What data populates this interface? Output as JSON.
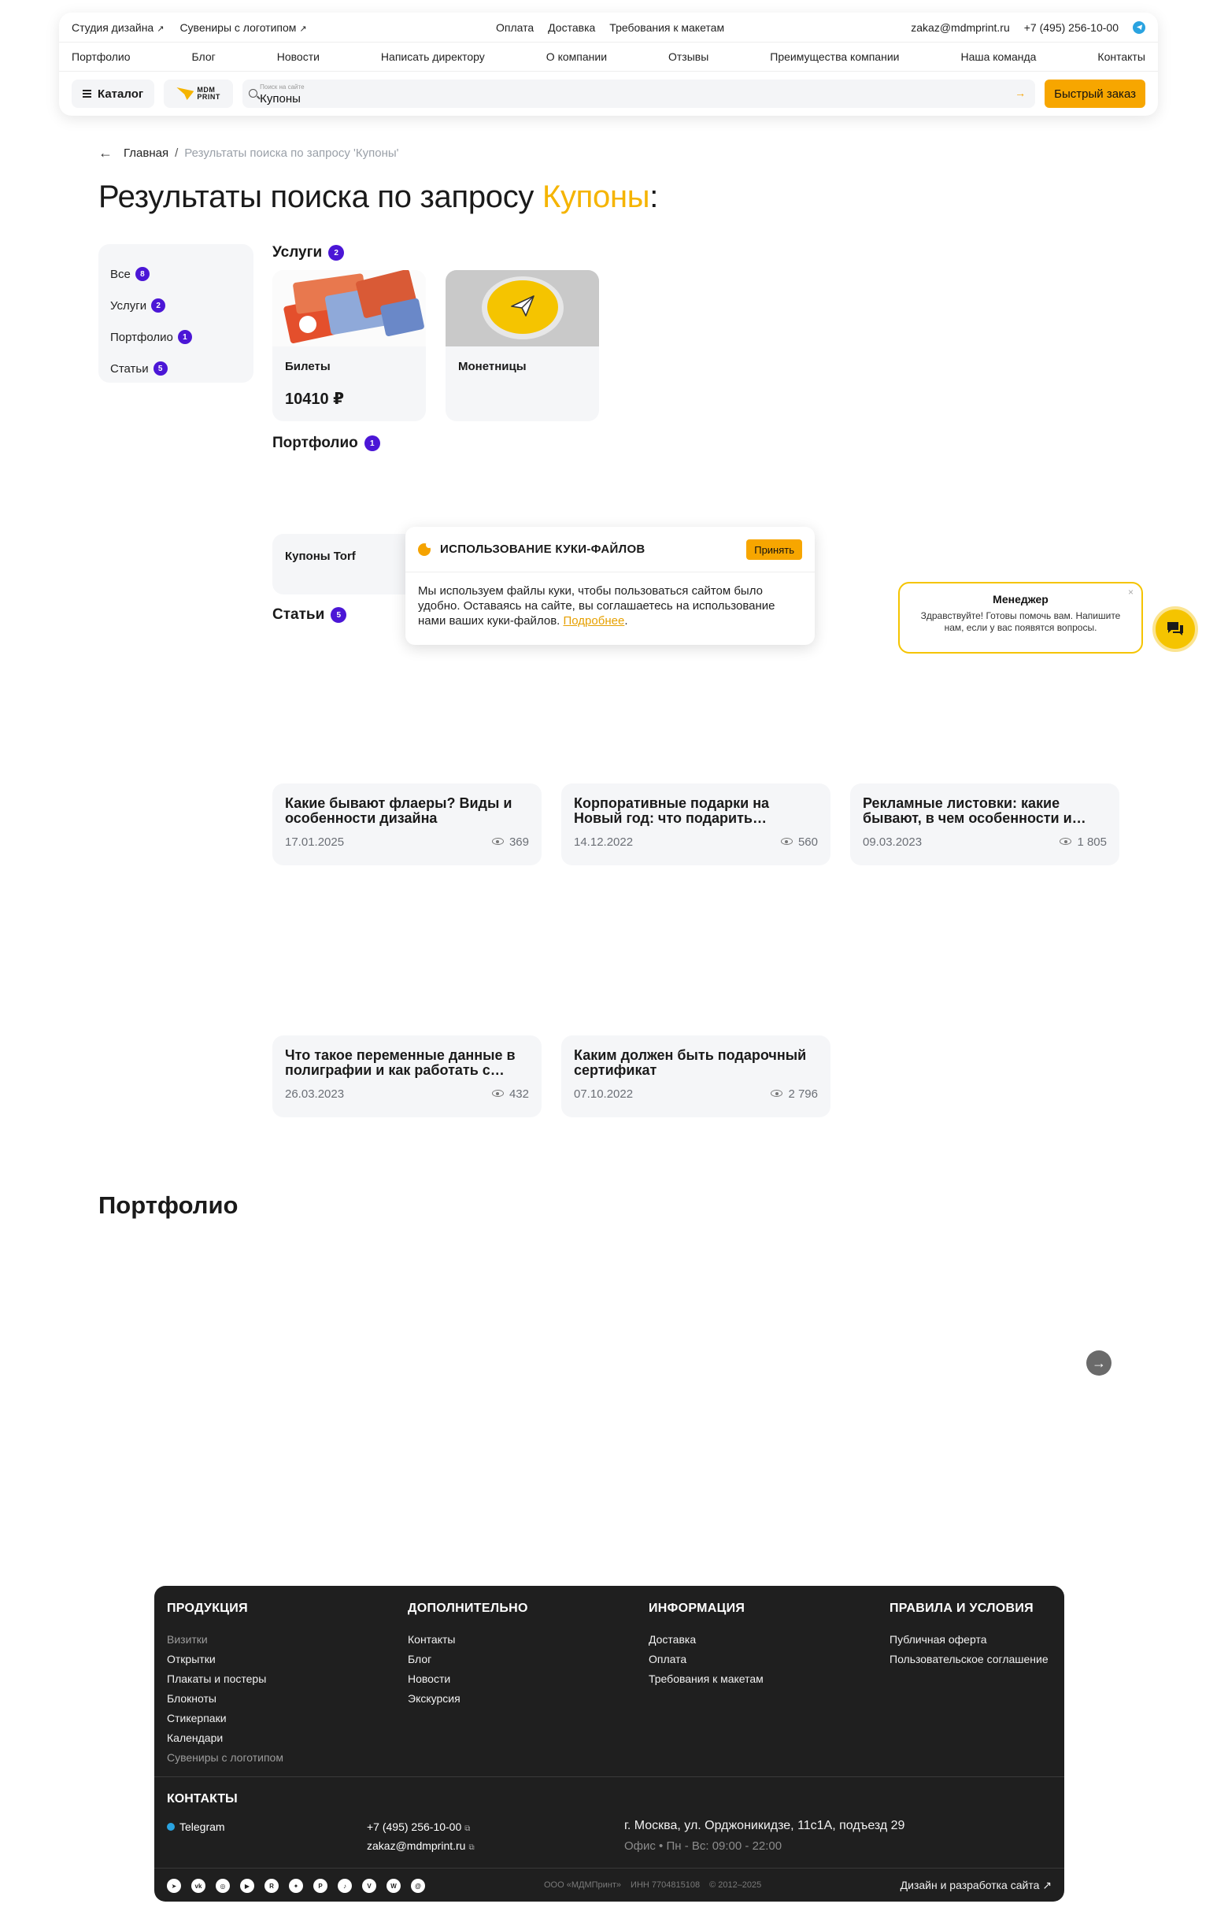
{
  "header": {
    "top_left": [
      {
        "label": "Студия дизайна",
        "arrow": "↗"
      },
      {
        "label": "Сувениры с логотипом",
        "arrow": "↗"
      }
    ],
    "top_center": [
      "Оплата",
      "Доставка",
      "Требования к макетам"
    ],
    "email": "zakaz@mdmprint.ru",
    "phone": "+7 (495) 256-10-00",
    "nav": [
      "Портфолио",
      "Блог",
      "Новости",
      "Написать директору",
      "О компании",
      "Отзывы",
      "Преимущества компании",
      "Наша команда",
      "Контакты"
    ],
    "catalog_label": "Каталог",
    "logo_text_1": "MDM",
    "logo_text_2": "PRINT",
    "search_placeholder": "Поиск на сайте",
    "search_value": "Купоны",
    "search_go": "→",
    "quick_order_label": "Быстрый заказ",
    "accent": "#f7a600"
  },
  "breadcrumb": {
    "back": "←",
    "home": "Главная",
    "sep": "/",
    "current": "Результаты поиска по запросу 'Купоны'"
  },
  "title": {
    "prefix": "Результаты поиска по запросу ",
    "query": "Купоны",
    "suffix": ":"
  },
  "filters": [
    {
      "label": "Все",
      "count": "8"
    },
    {
      "label": "Услуги",
      "count": "2"
    },
    {
      "label": "Портфолио",
      "count": "1"
    },
    {
      "label": "Статьи",
      "count": "5"
    }
  ],
  "sections": {
    "services": {
      "label": "Услуги",
      "count": "2"
    },
    "portfolio": {
      "label": "Портфолио",
      "count": "1"
    },
    "articles": {
      "label": "Статьи",
      "count": "5"
    }
  },
  "services": [
    {
      "name": "Билеты",
      "price": "10410 ₽"
    },
    {
      "name": "Монетницы",
      "price": ""
    }
  ],
  "portfolio_items": [
    {
      "name": "Купоны Torf"
    }
  ],
  "articles": [
    {
      "title": "Какие бывают флаеры? Виды и особенности дизайна",
      "date": "17.01.2025",
      "views": "369"
    },
    {
      "title": "Корпоративные подарки на Новый год: что подарить…",
      "date": "14.12.2022",
      "views": "560"
    },
    {
      "title": "Рекламные листовки: какие бывают, в чем особенности и…",
      "date": "09.03.2023",
      "views": "1 805"
    },
    {
      "title": "Что такое переменные данные в полиграфии и как работать с…",
      "date": "26.03.2023",
      "views": "432"
    },
    {
      "title": "Каким должен быть подарочный сертификат",
      "date": "07.10.2022",
      "views": "2 796"
    }
  ],
  "cookie": {
    "title": "ИСПОЛЬЗОВАНИЕ КУКИ-ФАЙЛОВ",
    "accept": "Принять",
    "text": "Мы используем файлы куки, чтобы пользоваться сайтом было удобно. Оставаясь на сайте, вы соглашаетесь на использование нами ваших куки-файлов.",
    "link": "Подробнее",
    "link_suffix": "."
  },
  "chat": {
    "title": "Менеджер",
    "text": "Здравствуйте! Готовы помочь вам. Напишите нам, если у вас появятся вопросы.",
    "close": "×"
  },
  "portfolio_section": {
    "title": "Портфолио",
    "next": "→"
  },
  "footer": {
    "columns": [
      {
        "head": "ПРОДУКЦИЯ",
        "links": [
          {
            "label": "Визитки",
            "dim": true
          },
          {
            "label": "Открытки",
            "dim": false
          },
          {
            "label": "Плакаты и постеры",
            "dim": false
          },
          {
            "label": "Блокноты",
            "dim": false
          },
          {
            "label": "Стикерпаки",
            "dim": false
          },
          {
            "label": "Календари",
            "dim": false
          },
          {
            "label": "Сувениры с логотипом",
            "dim": true
          }
        ]
      },
      {
        "head": "ДОПОЛНИТЕЛЬНО",
        "links": [
          {
            "label": "Контакты",
            "dim": false
          },
          {
            "label": "Блог",
            "dim": false
          },
          {
            "label": "Новости",
            "dim": false
          },
          {
            "label": "Экскурсия",
            "dim": false
          }
        ]
      },
      {
        "head": "ИНФОРМАЦИЯ",
        "links": [
          {
            "label": "Доставка",
            "dim": false
          },
          {
            "label": "Оплата",
            "dim": false
          },
          {
            "label": "Требования к макетам",
            "dim": false
          }
        ]
      },
      {
        "head": "ПРАВИЛА И УСЛОВИЯ",
        "links": [
          {
            "label": "Публичная оферта",
            "dim": false
          },
          {
            "label": "Пользовательское соглашение",
            "dim": false
          }
        ]
      }
    ],
    "contacts_head": "КОНТАКТЫ",
    "telegram": "Telegram",
    "phone": "+7 (495) 256-10-00",
    "email": "zakaz@mdmprint.ru",
    "address": "г. Москва, ул. Орджоникидзе, 11с1А, подъезд 29",
    "hours": "Офис • Пн - Вс: 09:00 - 22:00",
    "social": [
      "telegram-icon",
      "vk-icon",
      "instagram-icon",
      "youtube-icon",
      "rutube-icon",
      "dzen-icon",
      "pinterest-icon",
      "tiktok-icon",
      "viber-icon",
      "whatsapp-icon",
      "threads-icon"
    ],
    "legal_company": "ООО «МДМПринт»",
    "legal_inn": "ИНН 7704815108",
    "legal_years": "© 2012–2025",
    "dev_label": "Дизайн и разработка сайта",
    "dev_arrow": "↗"
  }
}
